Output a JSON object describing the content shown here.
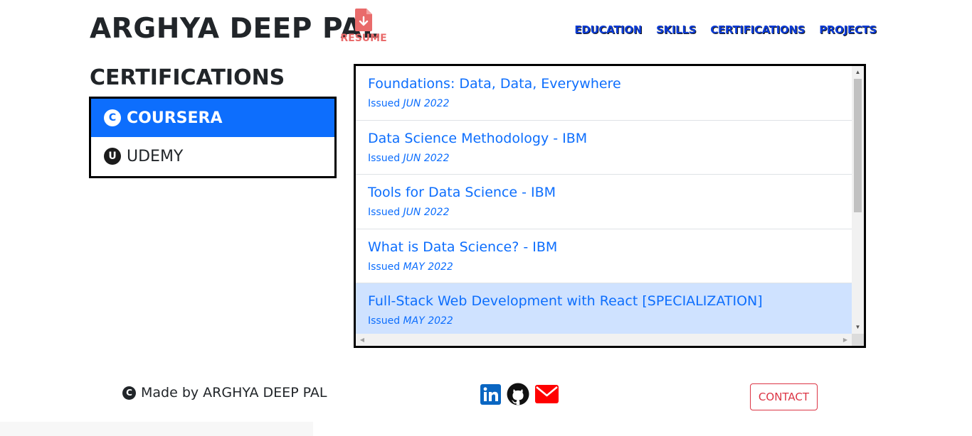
{
  "header": {
    "brand": "ARGHYA DEEP PAL",
    "resume_label": "RESUME",
    "resume_icon": "file-download-icon",
    "nav": [
      "EDUCATION",
      "SKILLS",
      "CERTIFICATIONS",
      "PROJECTS"
    ]
  },
  "section_title": "CERTIFICATIONS",
  "providers": [
    {
      "label": "COURSERA",
      "icon": "coursera-icon",
      "glyph": "C",
      "active": true
    },
    {
      "label": "UDEMY",
      "icon": "udemy-icon",
      "glyph": "U",
      "active": false
    }
  ],
  "certificates": [
    {
      "title": "Foundations: Data, Data, Everywhere",
      "issued_prefix": "Issued",
      "date": "JUN 2022"
    },
    {
      "title": "Data Science Methodology - IBM",
      "issued_prefix": "Issued",
      "date": "JUN 2022"
    },
    {
      "title": "Tools for Data Science - IBM",
      "issued_prefix": "Issued",
      "date": "JUN 2022"
    },
    {
      "title": "What is Data Science? - IBM",
      "issued_prefix": "Issued",
      "date": "MAY 2022"
    },
    {
      "title": "Full-Stack Web Development with React [SPECIALIZATION]",
      "issued_prefix": "Issued",
      "date": "MAY 2022",
      "highlight": true
    }
  ],
  "footer": {
    "made_by": "Made by ARGHYA DEEP PAL",
    "copyright_glyph": "C",
    "socials": [
      "linkedin-icon",
      "github-icon",
      "email-icon"
    ],
    "contact_label": "CONTACT"
  },
  "colors": {
    "accent": "#0d6efd",
    "contact": "#dc3545",
    "resume": "#e96b6b",
    "linkedin": "#0a66c2",
    "email": "#ff0000"
  }
}
